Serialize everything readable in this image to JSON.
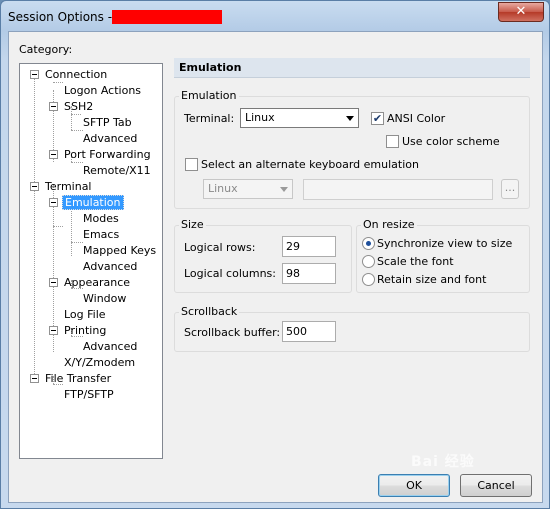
{
  "window": {
    "title": "Session Options -",
    "close_glyph": "✕"
  },
  "category_label": "Category:",
  "tree": {
    "connection": "Connection",
    "logon_actions": "Logon Actions",
    "ssh2": "SSH2",
    "sftp_tab": "SFTP Tab",
    "ssh2_advanced": "Advanced",
    "port_forwarding": "Port Forwarding",
    "remote_x11": "Remote/X11",
    "terminal": "Terminal",
    "emulation": "Emulation",
    "modes": "Modes",
    "emacs": "Emacs",
    "mapped_keys": "Mapped Keys",
    "emulation_advanced": "Advanced",
    "appearance": "Appearance",
    "window": "Window",
    "log_file": "Log File",
    "printing": "Printing",
    "printing_advanced": "Advanced",
    "xyzmodem": "X/Y/Zmodem",
    "file_transfer": "File Transfer",
    "ftp_sftp": "FTP/SFTP"
  },
  "panel": {
    "header": "Emulation",
    "emulation_group": {
      "title": "Emulation",
      "terminal_label": "Terminal:",
      "terminal_value": "Linux",
      "ansi_color_label": "ANSI Color",
      "ansi_color_checked": true,
      "use_color_scheme_label": "Use color scheme",
      "use_color_scheme_checked": false,
      "alt_keyboard_label": "Select an alternate keyboard emulation",
      "alt_keyboard_checked": false,
      "alt_keyboard_value": "Linux",
      "browse_label": "..."
    },
    "size_group": {
      "title": "Size",
      "rows_label": "Logical rows:",
      "rows_value": "29",
      "columns_label": "Logical columns:",
      "columns_value": "98"
    },
    "resize_group": {
      "title": "On resize",
      "options": [
        "Synchronize view to size",
        "Scale the font",
        "Retain size and font"
      ],
      "selected_index": 0
    },
    "scrollback_group": {
      "title": "Scrollback",
      "buffer_label": "Scrollback buffer:",
      "buffer_value": "500"
    }
  },
  "buttons": {
    "ok": "OK",
    "cancel": "Cancel"
  },
  "check_glyph": "✔",
  "watermark": "Bai 经验"
}
